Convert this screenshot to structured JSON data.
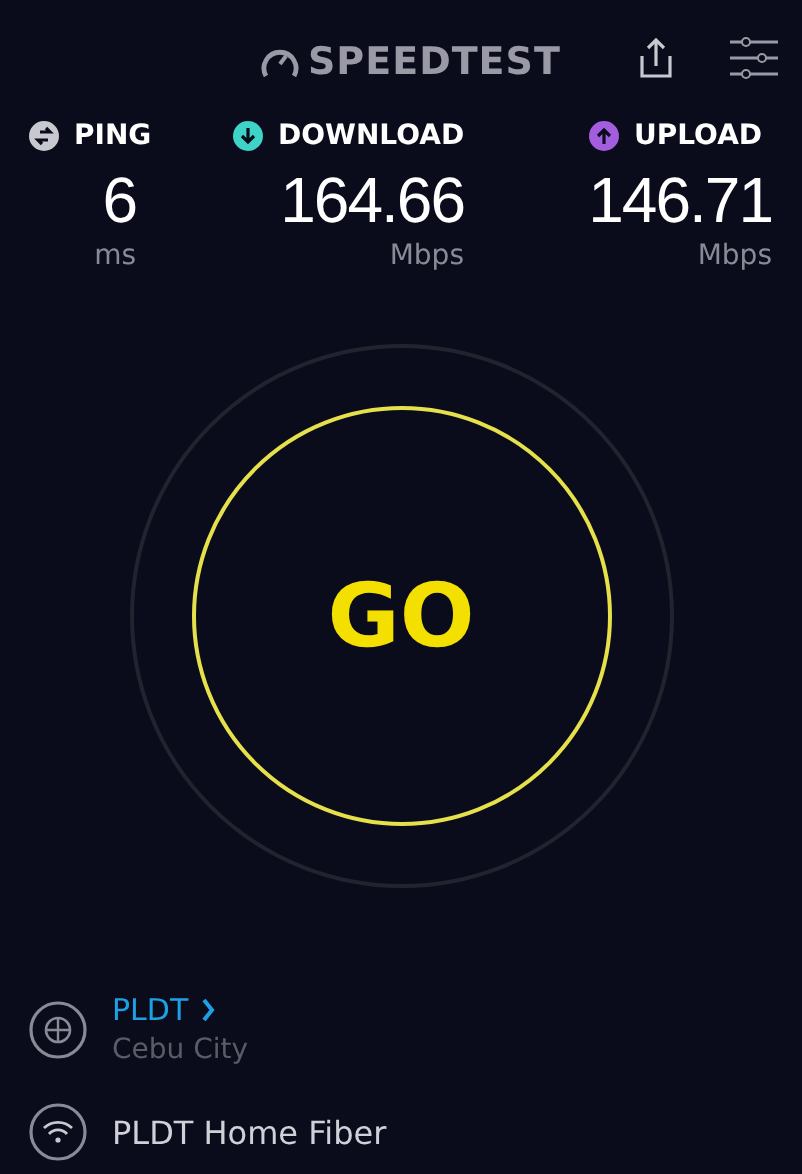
{
  "header": {
    "logo": "SPEEDTEST"
  },
  "metrics": [
    {
      "label": "PING",
      "value": "6",
      "unit": "ms",
      "kind": "ping",
      "color": "#c8c8d0"
    },
    {
      "label": "DOWNLOAD",
      "value": "164.66",
      "unit": "Mbps",
      "kind": "download",
      "color": "#3fd2c7"
    },
    {
      "label": "UPLOAD",
      "value": "146.71",
      "unit": "Mbps",
      "kind": "upload",
      "color": "#a35ee0"
    }
  ],
  "go_button": {
    "label": "GO"
  },
  "provider": {
    "name": "PLDT",
    "location": "Cebu City"
  },
  "network": {
    "name": "PLDT Home Fiber"
  }
}
